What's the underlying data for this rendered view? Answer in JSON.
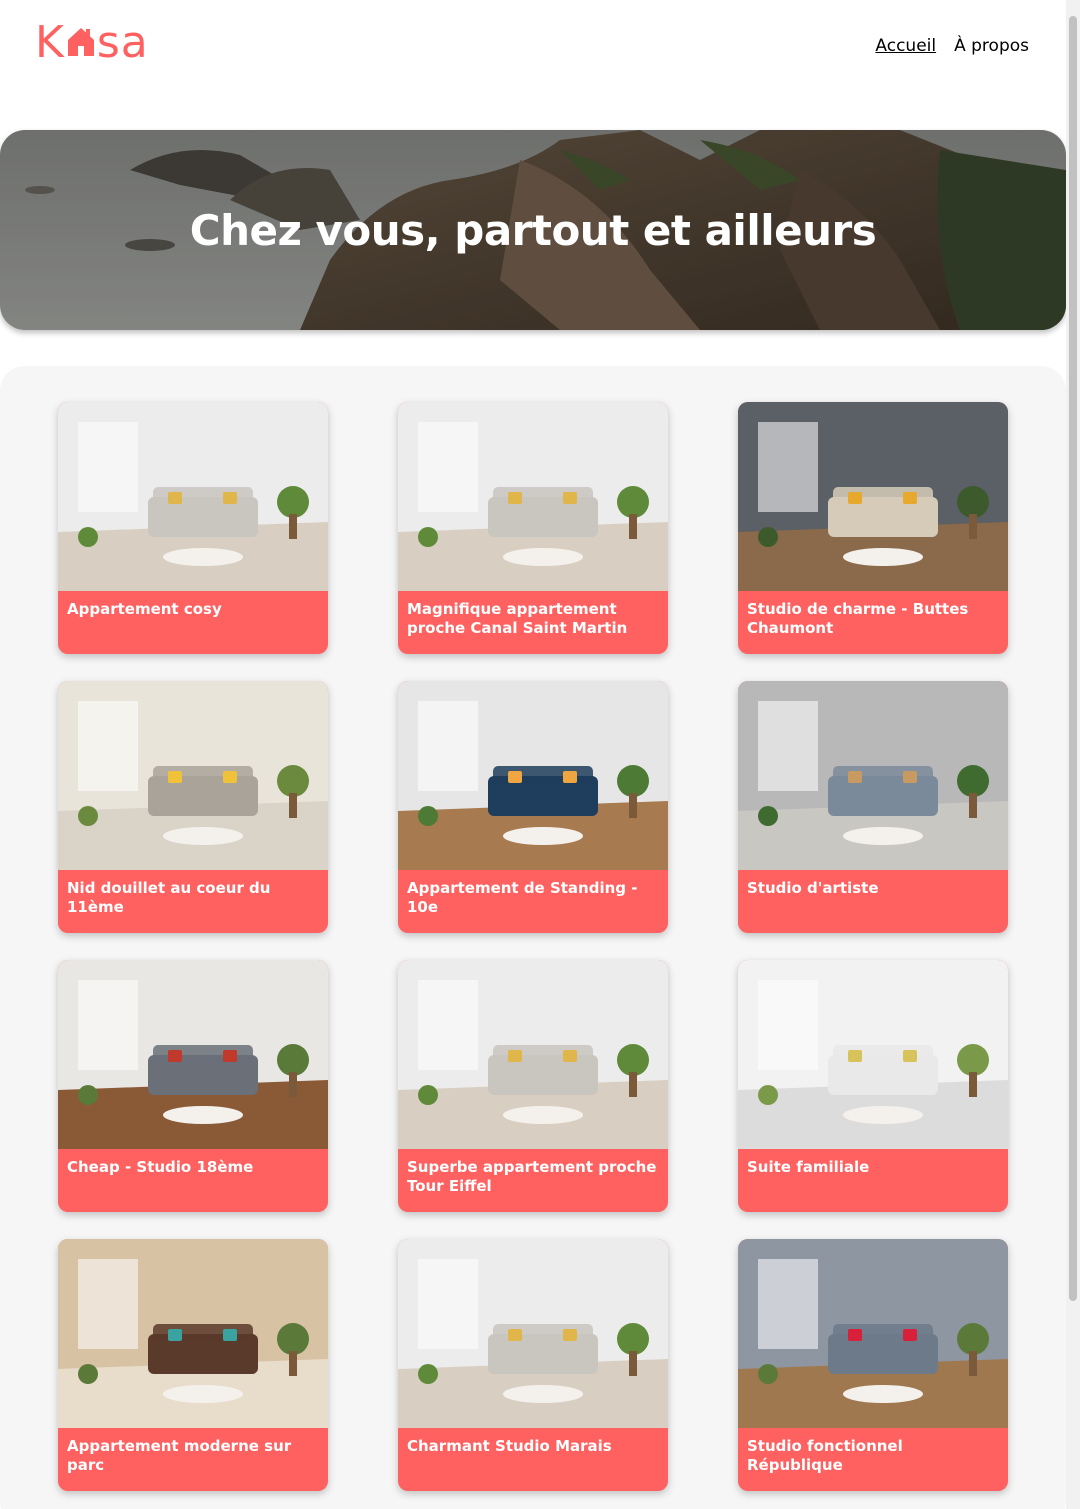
{
  "logo": {
    "text_start": "K",
    "text_end": "sa",
    "brand_color": "#FF6060"
  },
  "nav": {
    "home": "Accueil",
    "about": "À propos"
  },
  "banner": {
    "title": "Chez vous, partout et ailleurs"
  },
  "listings": [
    {
      "title": "Appartement cosy",
      "theme": "white"
    },
    {
      "title": "Magnifique appartement proche Canal Saint Martin",
      "theme": "white"
    },
    {
      "title": "Studio de charme - Buttes Chaumont",
      "theme": "dark"
    },
    {
      "title": "Nid douillet au coeur du 11ème",
      "theme": "beige"
    },
    {
      "title": "Appartement de Standing - 10e",
      "theme": "navy"
    },
    {
      "title": "Studio d'artiste",
      "theme": "grey"
    },
    {
      "title": "Cheap - Studio 18ème",
      "theme": "kitchen"
    },
    {
      "title": "Superbe appartement proche Tour Eiffel",
      "theme": "white"
    },
    {
      "title": "Suite familiale",
      "theme": "bright"
    },
    {
      "title": "Appartement moderne sur parc",
      "theme": "brown"
    },
    {
      "title": "Charmant Studio Marais",
      "theme": "white"
    },
    {
      "title": "Studio fonctionnel République",
      "theme": "bedroom"
    }
  ]
}
